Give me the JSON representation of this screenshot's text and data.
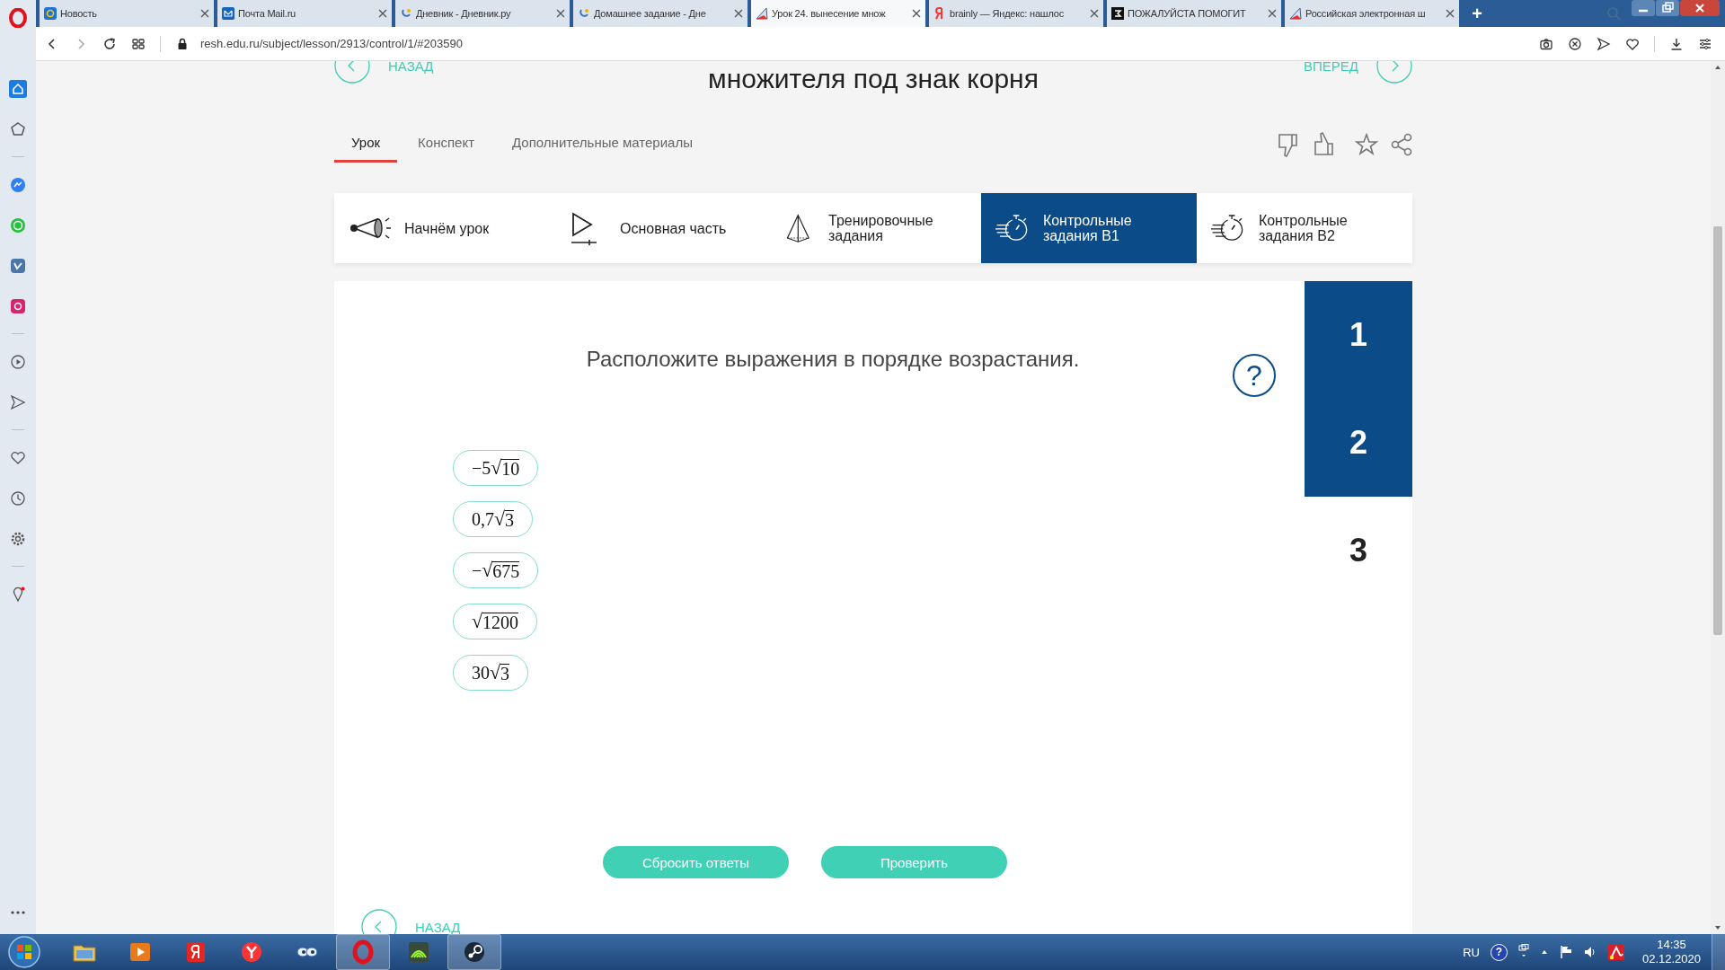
{
  "browser": {
    "tabs": [
      {
        "kind": "at",
        "title": "Новость",
        "selected": false
      },
      {
        "kind": "mail",
        "title": "Почта Mail.ru",
        "selected": false
      },
      {
        "kind": "swirl",
        "title": "Дневник - Дневник.ру",
        "selected": false
      },
      {
        "kind": "swirl",
        "title": "Домашнее задание - Дне",
        "selected": false
      },
      {
        "kind": "triangle",
        "title": "Урок 24. вынесение множ",
        "selected": true
      },
      {
        "kind": "red",
        "title": "brainly — Яндекс: нашлос",
        "selected": false
      },
      {
        "kind": "black",
        "title": "ПОЖАЛУЙСТА ПОМОГИТ",
        "selected": false
      },
      {
        "kind": "triangle",
        "title": "Российская электронная ш",
        "selected": false
      }
    ],
    "new_tab": "+",
    "address": "resh.edu.ru/subject/lesson/2913/control/1/#203590"
  },
  "sidebar": {
    "groups": [
      [
        {
          "kind": "home",
          "selected": true
        },
        {
          "kind": "pentagon",
          "selected": false
        }
      ],
      [
        {
          "kind": "bubble",
          "selected": false
        },
        {
          "kind": "phone",
          "selected": false
        },
        {
          "kind": "square",
          "selected": false
        },
        {
          "kind": "camera",
          "selected": false
        }
      ],
      [
        {
          "kind": "play",
          "selected": false
        },
        {
          "kind": "send",
          "selected": false
        }
      ],
      [
        {
          "kind": "heart",
          "selected": false
        },
        {
          "kind": "clock",
          "selected": false
        },
        {
          "kind": "gear",
          "selected": false
        }
      ],
      [
        {
          "kind": "pin",
          "selected": false
        }
      ]
    ]
  },
  "lesson": {
    "back": "НАЗАД",
    "forward": "ВПЕРЕД",
    "title": "множителя под знак корня",
    "tabs": [
      {
        "label": "Урок",
        "selected": true
      },
      {
        "label": "Конспект",
        "selected": false
      },
      {
        "label": "Дополнительные материалы",
        "selected": false
      }
    ],
    "sections": [
      {
        "kind": "megaphone",
        "label": "Начнём урок",
        "selected": false
      },
      {
        "kind": "play",
        "label": "Основная часть",
        "selected": false
      },
      {
        "kind": "pyramid",
        "label": "Тренировочные задания",
        "selected": false
      },
      {
        "kind": "timer",
        "label": "Контрольные задания В1",
        "selected": true
      },
      {
        "kind": "timer",
        "label": "Контрольные задания В2",
        "selected": false
      }
    ]
  },
  "task": {
    "question": "Расположите выражения в порядке возрастания.",
    "help": "?",
    "items": [
      {
        "prefix": "−5",
        "sign": "√",
        "radicand": "10"
      },
      {
        "prefix": "0,7",
        "sign": "√",
        "radicand": "3"
      },
      {
        "prefix": "−",
        "sign": "√",
        "radicand": "675"
      },
      {
        "sign": "√",
        "radicand": "1200"
      },
      {
        "prefix": "30",
        "sign": "√",
        "radicand": "3"
      }
    ],
    "numbers": [
      {
        "label": "1",
        "selected": true
      },
      {
        "label": "2",
        "selected": true
      },
      {
        "label": "3",
        "selected": false
      }
    ],
    "buttons": [
      "Сбросить ответы",
      "Проверить"
    ]
  },
  "bottom_nav": {
    "back": "НАЗАД"
  },
  "taskbar": {
    "apps": [
      {
        "kind": "folder",
        "running": false
      },
      {
        "kind": "player",
        "running": false
      },
      {
        "kind": "redsquare",
        "running": false
      },
      {
        "kind": "redcircle",
        "running": false
      },
      {
        "kind": "eyes",
        "running": false
      },
      {
        "kind": "ring",
        "running": true
      },
      {
        "kind": "network",
        "running": false
      },
      {
        "kind": "steam",
        "running": true
      }
    ],
    "language": "RU",
    "help": "?",
    "time": "14:35",
    "date": "02.12.2020"
  }
}
